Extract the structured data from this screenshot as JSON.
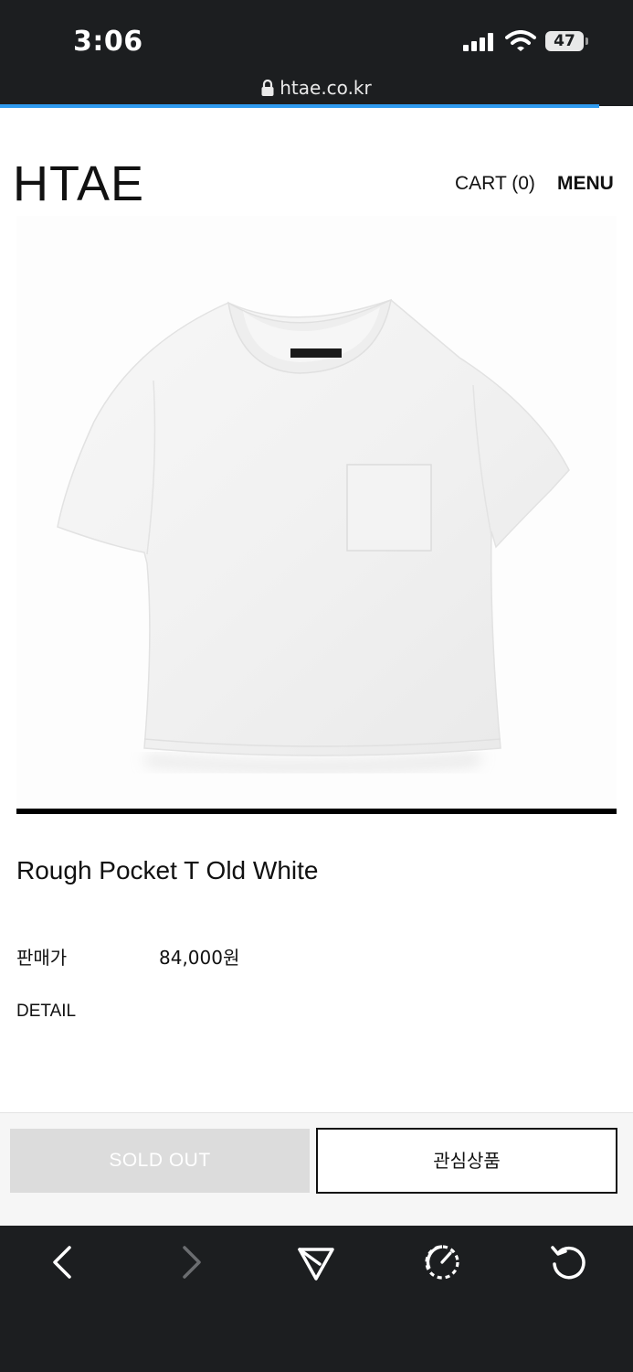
{
  "status_bar": {
    "time": "3:06",
    "battery": "47",
    "url": "htae.co.kr"
  },
  "header": {
    "logo": "HTAE",
    "cart_label": "CART (0)",
    "menu_label": "MENU"
  },
  "product": {
    "image_alt": "white t-shirt with chest pocket",
    "name": "Rough Pocket T Old White",
    "price_label": "판매가",
    "price": "84,000원",
    "detail_label": "DETAIL"
  },
  "actions": {
    "sold_out_label": "SOLD OUT",
    "wishlist_label": "관심상품"
  },
  "browser_toolbar": {
    "icons": [
      "back-icon",
      "forward-icon",
      "share-icon",
      "speed-dial-icon",
      "reload-icon"
    ]
  },
  "colors": {
    "system_bar": "#1c1e20",
    "progress_accent": "#2f9bf0",
    "sold_out_bg": "#dcdcdc"
  }
}
